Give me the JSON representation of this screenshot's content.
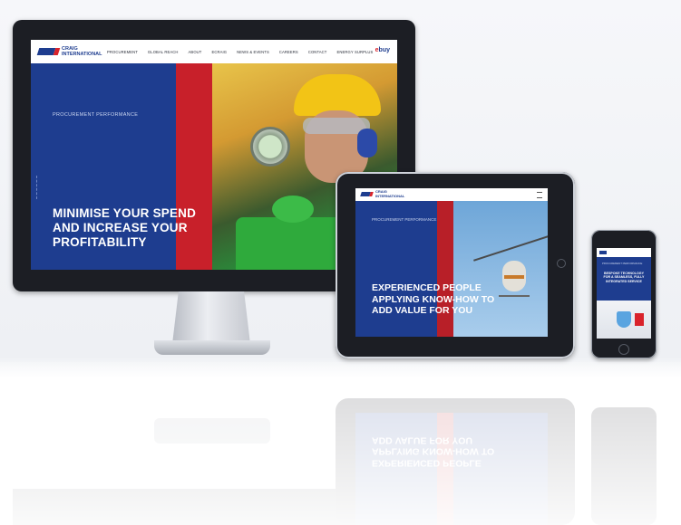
{
  "desktop": {
    "logo": {
      "line1": "CRAIG",
      "line2": "INTERNATIONAL"
    },
    "nav": [
      "PROCUREMENT",
      "GLOBAL REACH",
      "ABOUT",
      "ECRAIG",
      "NEWS & EVENTS",
      "CAREERS",
      "CONTACT",
      "ENERGY SURPLUS"
    ],
    "ebuy": {
      "prefix": "e",
      "rest": "buy"
    },
    "kicker": "PROCUREMENT PERFORMANCE",
    "headline": "MINIMISE YOUR SPEND AND INCREASE YOUR PROFITABILITY"
  },
  "tablet": {
    "logo": {
      "line1": "CRAIG",
      "line2": "INTERNATIONAL"
    },
    "kicker": "PROCUREMENT PERFORMANCE",
    "headline": "EXPERIENCED PEOPLE APPLYING KNOW-HOW TO ADD VALUE FOR YOU"
  },
  "phone": {
    "kicker": "PROCUREMENT PERFORMANCE",
    "headline": "BESPOKE TECHNOLOGY FOR A SEAMLESS, FULLY INTEGRATED SERVICE"
  },
  "colors": {
    "brand_blue": "#1e3d8f",
    "brand_red": "#c8202a",
    "white": "#ffffff"
  },
  "icons": {
    "apple": "apple-logo-icon",
    "menu": "hamburger-menu-icon",
    "home": "home-button-icon"
  }
}
